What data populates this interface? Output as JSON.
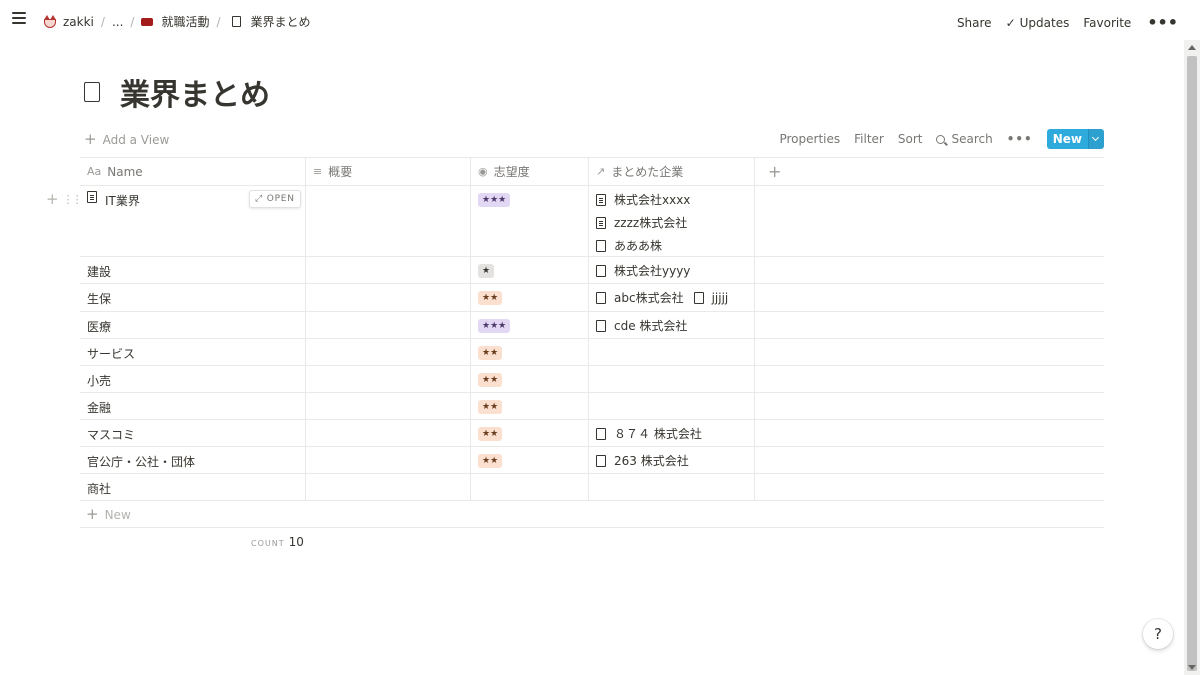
{
  "topbar": {
    "breadcrumb": [
      "zakki",
      "...",
      "就職活動",
      "業界まとめ"
    ],
    "actions": {
      "share": "Share",
      "updates": "Updates",
      "favorite": "Favorite"
    }
  },
  "page": {
    "title": "業界まとめ"
  },
  "viewbar": {
    "add_view": "Add a View",
    "properties": "Properties",
    "filter": "Filter",
    "sort": "Sort",
    "search": "Search",
    "new": "New"
  },
  "table": {
    "columns": [
      "Name",
      "概要",
      "志望度",
      "まとめた企業"
    ],
    "open_label": "OPEN",
    "rows": [
      {
        "name": "IT業界",
        "rating": "★★★",
        "rating_color": "#e3d8f3",
        "companies": [
          "株式会社xxxx",
          "zzzz株式会社",
          "あああ株"
        ]
      },
      {
        "name": "建設",
        "rating": "★",
        "rating_color": "#e3e2e0",
        "companies": [
          "株式会社yyyy"
        ]
      },
      {
        "name": "生保",
        "rating": "★★",
        "rating_color": "#fbdfcf",
        "companies": [
          "abc株式会社",
          "jjjjj"
        ]
      },
      {
        "name": "医療",
        "rating": "★★★",
        "rating_color": "#e3d8f3",
        "companies": [
          "cde 株式会社"
        ]
      },
      {
        "name": "サービス",
        "rating": "★★",
        "rating_color": "#fbdfcf",
        "companies": []
      },
      {
        "name": "小売",
        "rating": "★★",
        "rating_color": "#fbdfcf",
        "companies": []
      },
      {
        "name": "金融",
        "rating": "★★",
        "rating_color": "#fbdfcf",
        "companies": []
      },
      {
        "name": "マスコミ",
        "rating": "★★",
        "rating_color": "#fbdfcf",
        "companies": [
          "８７４ 株式会社"
        ]
      },
      {
        "name": "官公庁・公社・団体",
        "rating": "★★",
        "rating_color": "#fbdfcf",
        "companies": [
          "263 株式会社"
        ]
      },
      {
        "name": "商社",
        "rating": "",
        "rating_color": "",
        "companies": []
      }
    ],
    "new_row_label": "New",
    "count_label": "COUNT",
    "count_value": "10"
  },
  "help": "?"
}
